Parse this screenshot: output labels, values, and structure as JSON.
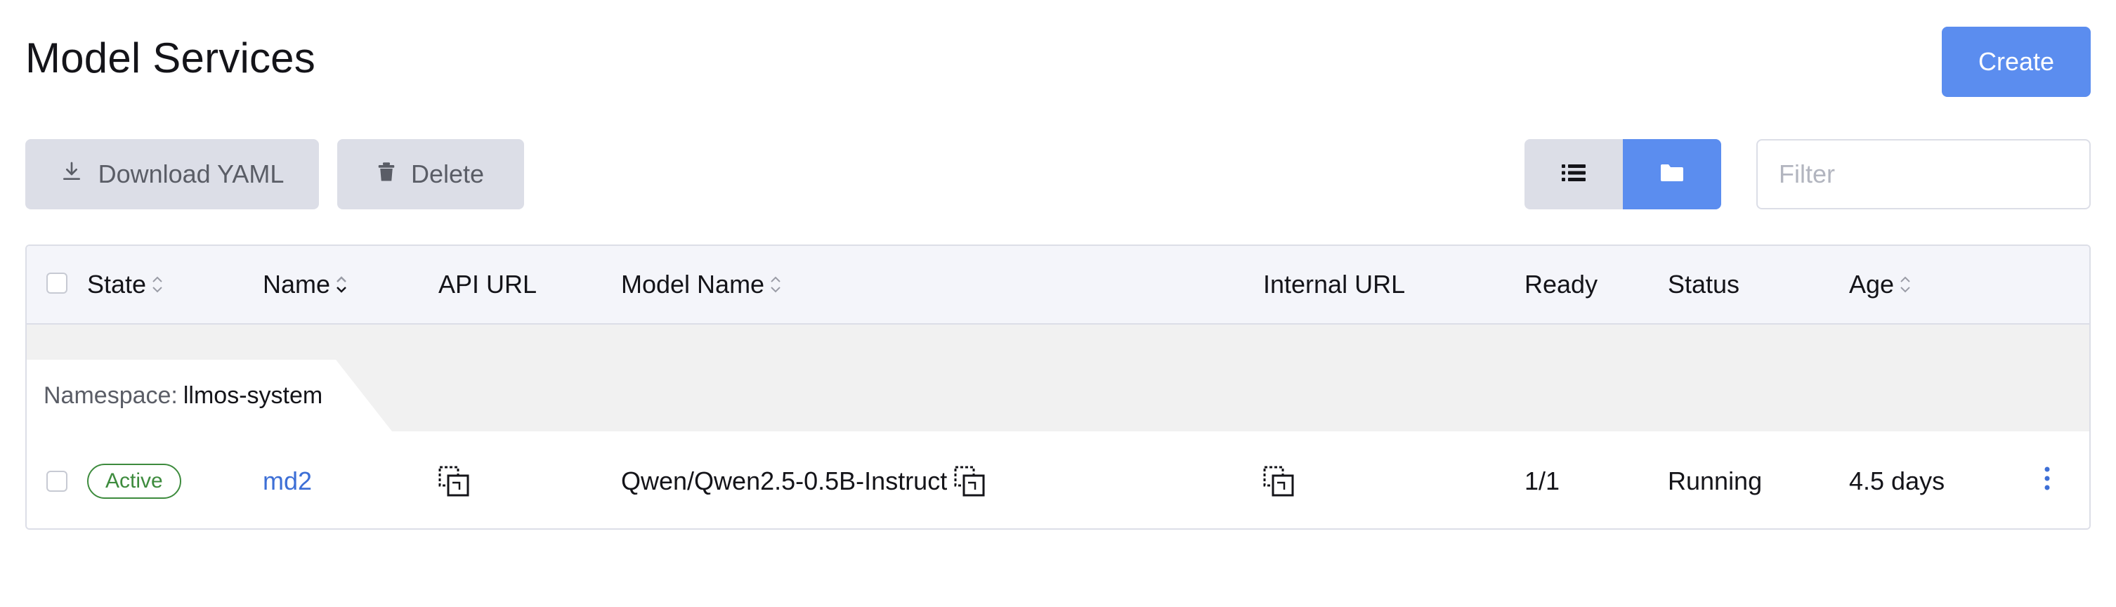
{
  "page": {
    "title": "Model Services"
  },
  "actions": {
    "create_label": "Create"
  },
  "toolbar": {
    "download_label": "Download YAML",
    "delete_label": "Delete",
    "filter_placeholder": "Filter"
  },
  "table": {
    "columns": {
      "state": "State",
      "name": "Name",
      "api_url": "API URL",
      "model_name": "Model Name",
      "internal_url": "Internal URL",
      "ready": "Ready",
      "status": "Status",
      "age": "Age"
    },
    "groups": [
      {
        "label": "Namespace:",
        "value": "llmos-system",
        "rows": [
          {
            "state": "Active",
            "name": "md2",
            "model_name": "Qwen/Qwen2.5-0.5B-Instruct",
            "ready": "1/1",
            "status": "Running",
            "age": "4.5 days"
          }
        ]
      }
    ]
  },
  "colors": {
    "accent": "#5b8def",
    "active_green": "#3d8b3d",
    "link_blue": "#3d6fd6",
    "button_gray": "#dcdee7"
  },
  "icons": {
    "download": "download-icon",
    "delete": "trash-icon",
    "list_view": "list-icon",
    "folder_view": "folder-icon",
    "sort": "sort-icon",
    "copy": "copy-icon",
    "more": "kebab-icon"
  }
}
